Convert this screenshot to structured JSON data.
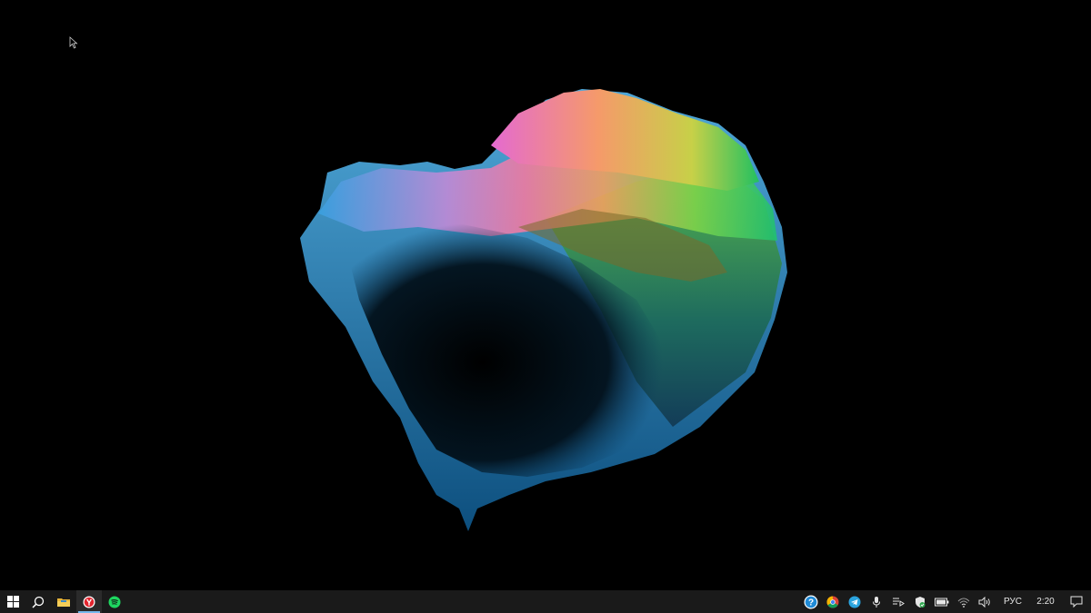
{
  "taskbar": {
    "pinned": [
      {
        "name": "start-button",
        "icon": "windows-logo-icon"
      },
      {
        "name": "search-button",
        "icon": "search-icon"
      },
      {
        "name": "file-explorer-button",
        "icon": "folder-icon"
      },
      {
        "name": "yandex-browser-button",
        "icon": "yandex-icon",
        "active": true
      },
      {
        "name": "spotify-button",
        "icon": "spotify-icon"
      }
    ],
    "tray": {
      "icons": [
        "help-icon",
        "chrome-icon",
        "telegram-icon",
        "microphone-icon",
        "media-icon",
        "defender-icon",
        "battery-icon",
        "wifi-icon",
        "volume-icon"
      ],
      "language": "РУС",
      "time": "2:20"
    }
  },
  "colors": {
    "taskbar_bg": "#1a1a1a",
    "accent": "#76b9ed",
    "desktop_bg": "#000000"
  }
}
